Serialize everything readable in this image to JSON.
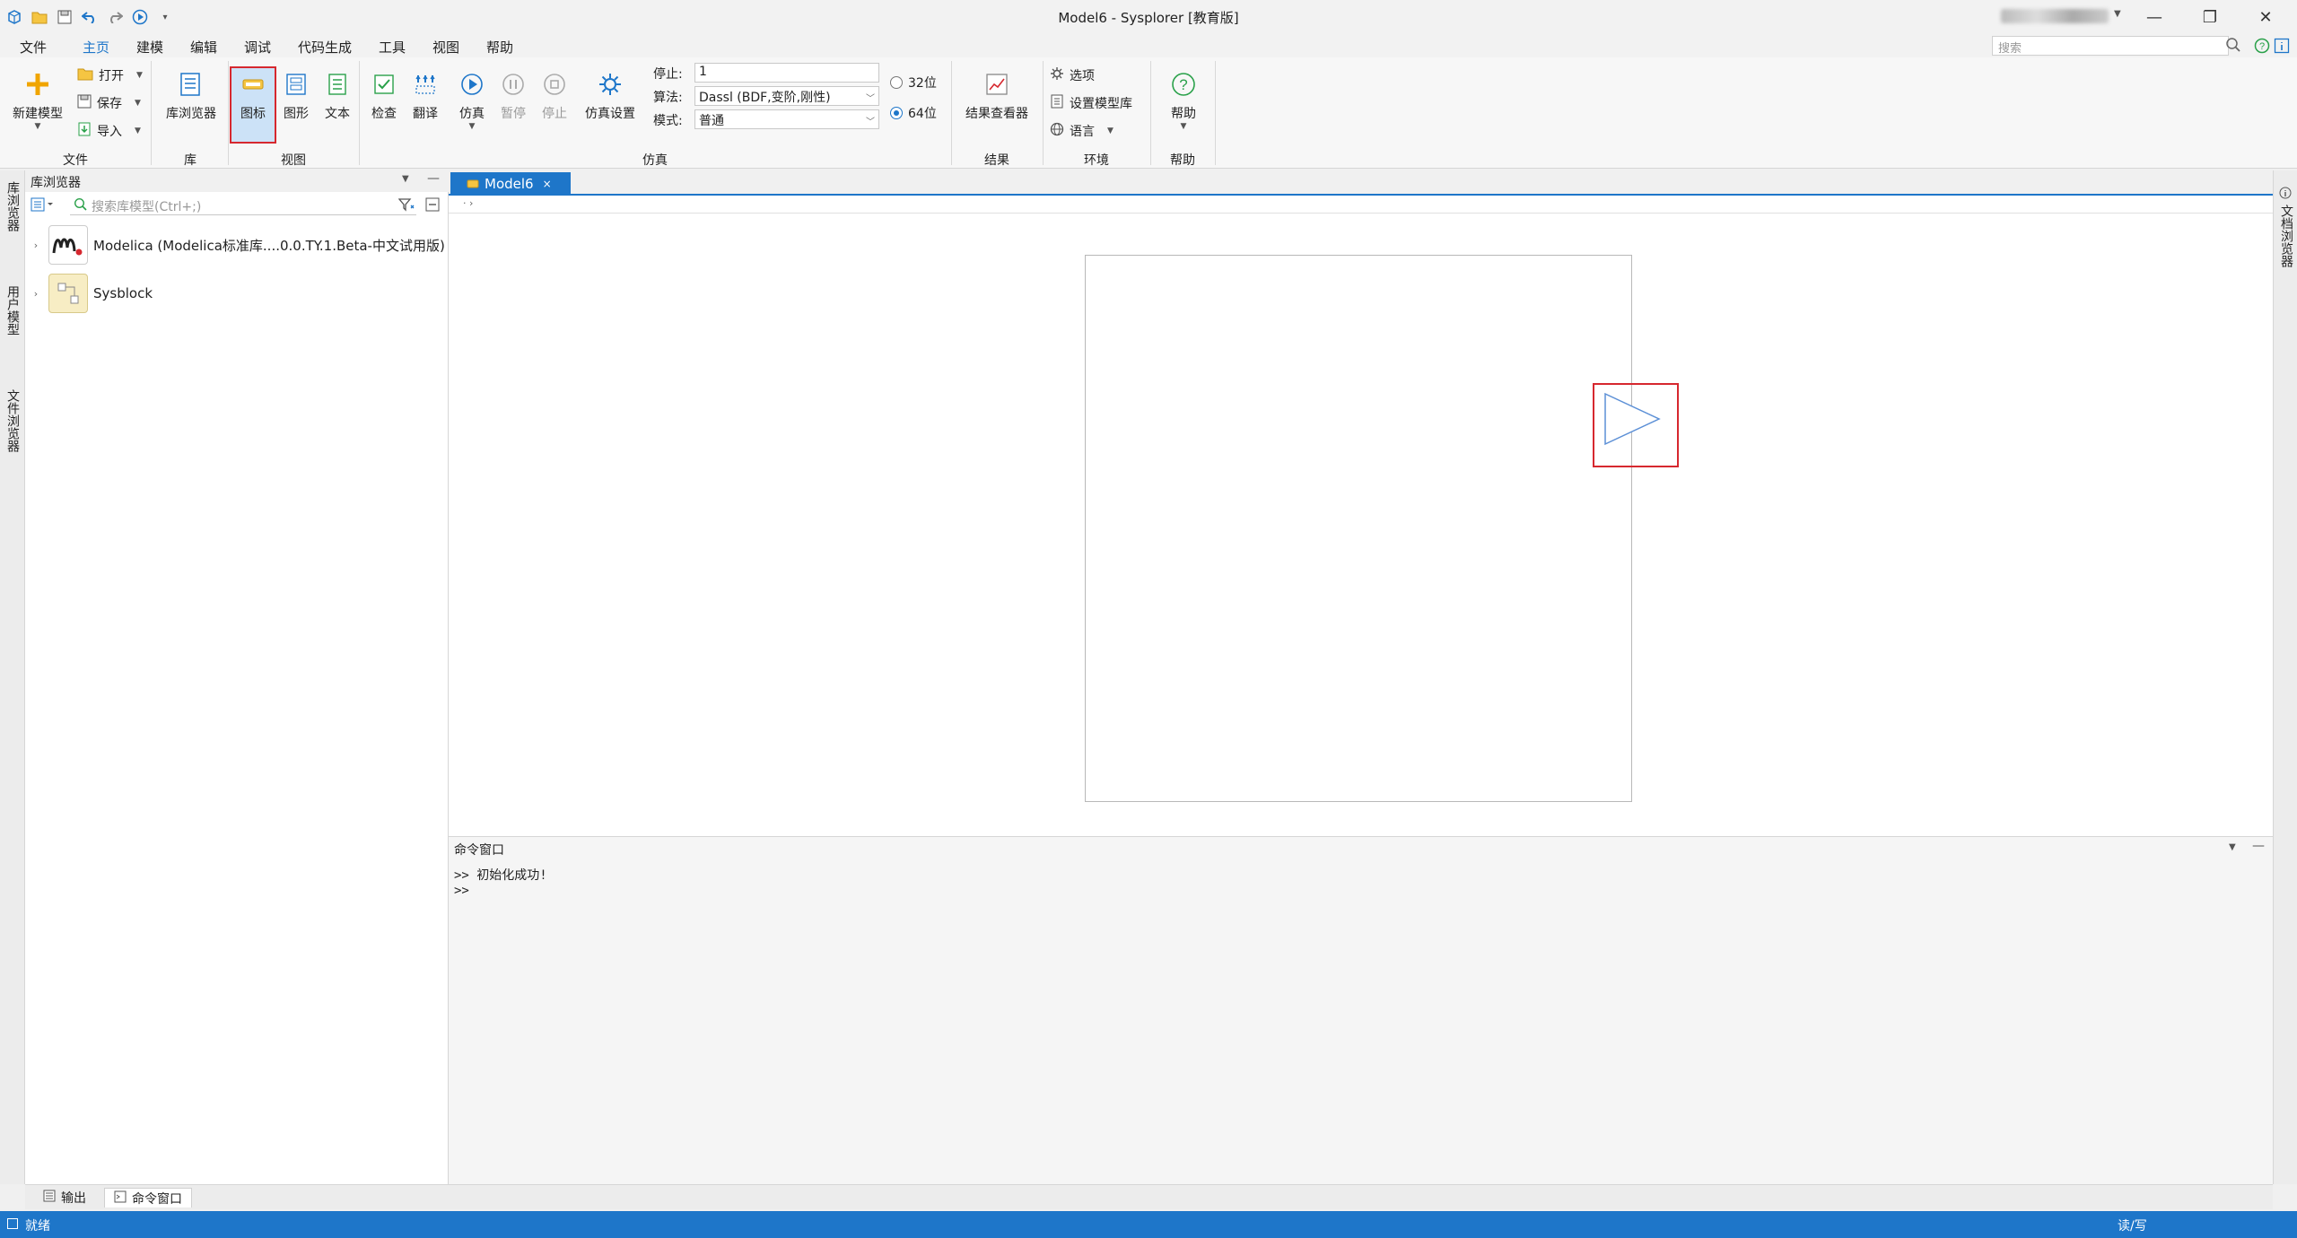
{
  "window": {
    "title": "Model6 - Sysplorer [教育版]",
    "minimize": "—",
    "restore": "❐",
    "close": "✕"
  },
  "menu": {
    "items": [
      "文件",
      "主页",
      "建模",
      "编辑",
      "调试",
      "代码生成",
      "工具",
      "视图",
      "帮助"
    ],
    "active": "主页",
    "search_placeholder": "搜索"
  },
  "ribbon": {
    "file": {
      "new_model": "新建模型",
      "open": "打开",
      "save": "保存",
      "import": "导入",
      "group": "文件"
    },
    "lib": {
      "lib_browser": "库浏览器",
      "group": "库"
    },
    "view": {
      "icon": "图标",
      "diagram": "图形",
      "text": "文本",
      "group": "视图"
    },
    "sim": {
      "check": "检查",
      "translate": "翻译",
      "simulate": "仿真",
      "pause": "暂停",
      "stop": "停止",
      "settings": "仿真设置",
      "stop_label": "停止:",
      "stop_value": "1",
      "algo_label": "算法:",
      "algo_value": "Dassl (BDF,变阶,刚性)",
      "mode_label": "模式:",
      "mode_value": "普通",
      "bit32": "32位",
      "bit64": "64位",
      "group": "仿真"
    },
    "result": {
      "viewer": "结果查看器",
      "group": "结果"
    },
    "env": {
      "options": "选项",
      "model_lib": "设置模型库",
      "language": "语言",
      "group": "环境"
    },
    "help": {
      "help": "帮助",
      "group": "帮助"
    }
  },
  "left_strip": {
    "tabs": [
      "库浏览器",
      "用户模型",
      "文件浏览器"
    ]
  },
  "right_strip": {
    "tabs": [
      "文档浏览器"
    ]
  },
  "lib_browser": {
    "title": "库浏览器",
    "search_placeholder": "搜索库模型(Ctrl+;)",
    "items": [
      {
        "label": "Modelica (Modelica标准库....0.0.TY.1.Beta-中文试用版)"
      },
      {
        "label": "Sysblock"
      }
    ]
  },
  "editor": {
    "tab": "Model6",
    "breadcrumb": "·  ›"
  },
  "cmd_window": {
    "title": "命令窗口",
    "lines": [
      ">> 初始化成功!",
      ">>"
    ]
  },
  "bottom_tabs": {
    "output": "输出",
    "cmd": "命令窗口"
  },
  "status": {
    "ready": "就绪",
    "mode": "读/写"
  },
  "colors": {
    "accent": "#1e76c9",
    "highlight": "#d6282f"
  }
}
